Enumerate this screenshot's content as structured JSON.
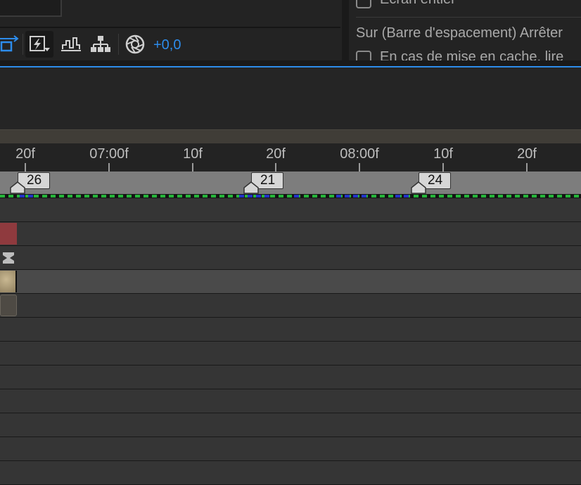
{
  "toolbar": {
    "exposure_value": "+0,0",
    "buttons": [
      {
        "name": "fit-layer-icon"
      },
      {
        "name": "fast-previews-icon"
      },
      {
        "name": "channel-graph-icon"
      },
      {
        "name": "flowchart-icon"
      },
      {
        "name": "aperture-icon"
      }
    ]
  },
  "preview_panel": {
    "fullscreen_label": "Écran entier",
    "shortcut_label": "Sur (Barre d'espacement) Arrêter",
    "cache_label": "En cas de mise en cache, lire"
  },
  "timeline": {
    "ruler_labels": [
      "20f",
      "07:00f",
      "10f",
      "20f",
      "08:00f",
      "10f",
      "20f"
    ],
    "markers": [
      "26",
      "21",
      "24"
    ],
    "layer_colors": [
      "#8f3a3e",
      "#4a4a4a",
      "#a89a7a",
      "#4e4a44"
    ]
  }
}
